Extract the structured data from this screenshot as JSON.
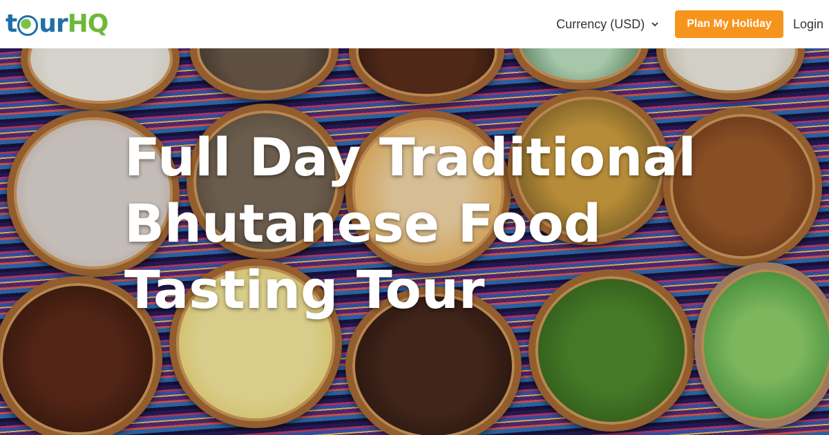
{
  "header": {
    "logo": {
      "part_t": "t",
      "part_ur": "ur",
      "part_hq": "HQ"
    },
    "currency_label": "Currency (USD)",
    "plan_button": "Plan My Holiday",
    "login_link": "Login",
    "icons": {
      "currency_dropdown": "chevron-down-icon",
      "logo_globe": "globe-icon"
    }
  },
  "hero": {
    "title": "Full Day Traditional Bhutanese Food Tasting Tour"
  },
  "colors": {
    "brand_blue": "#1f6fa8",
    "brand_green": "#6fb83a",
    "accent_orange": "#f7941d"
  }
}
